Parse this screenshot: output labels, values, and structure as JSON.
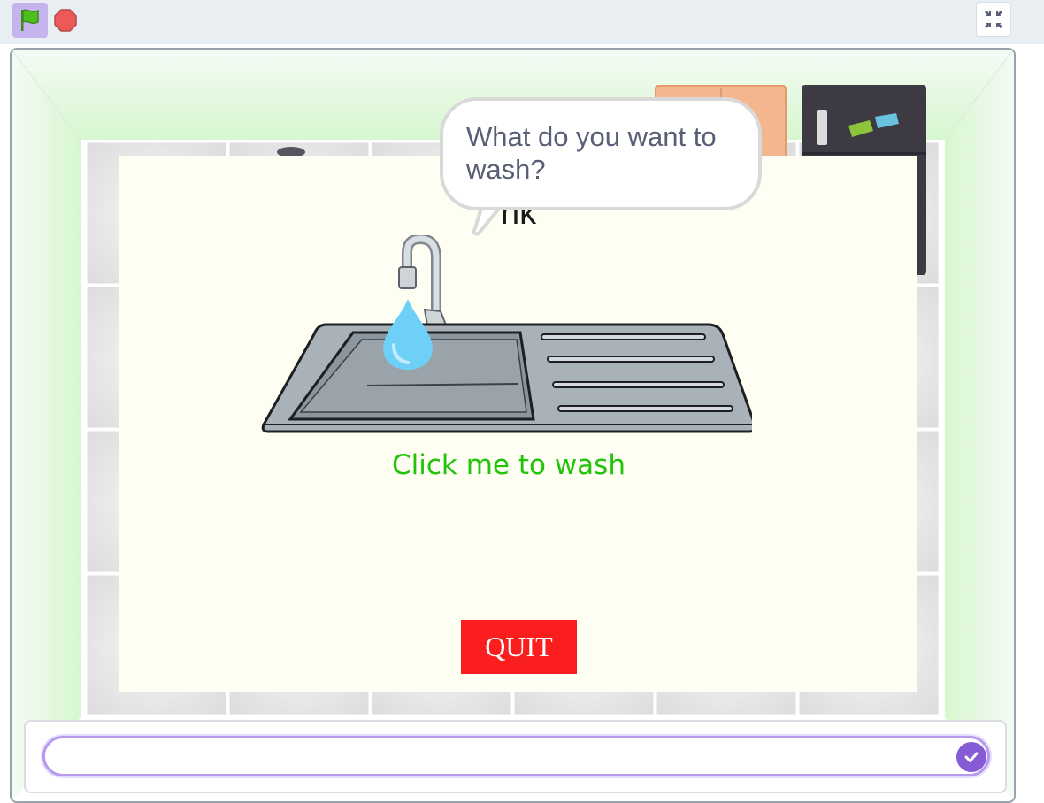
{
  "toolbar": {
    "green_flag_icon": "green-flag-icon",
    "stop_icon": "stop-sign-icon",
    "fullscreen_icon": "exit-fullscreen-icon"
  },
  "stage": {
    "sink_label": "nk",
    "click_text": "Click me to wash",
    "quit_label": "QUIT",
    "speech_bubble": "What do you want to wash?"
  },
  "ask": {
    "value": "",
    "submit_icon": "check-icon"
  },
  "colors": {
    "flag_active_bg": "#c6b4ee",
    "stop_red": "#ec5959",
    "quit_red": "#fb1e1e",
    "click_green": "#21c30b",
    "panel_bg": "#fffef2",
    "accent_purple": "#855cd6"
  }
}
